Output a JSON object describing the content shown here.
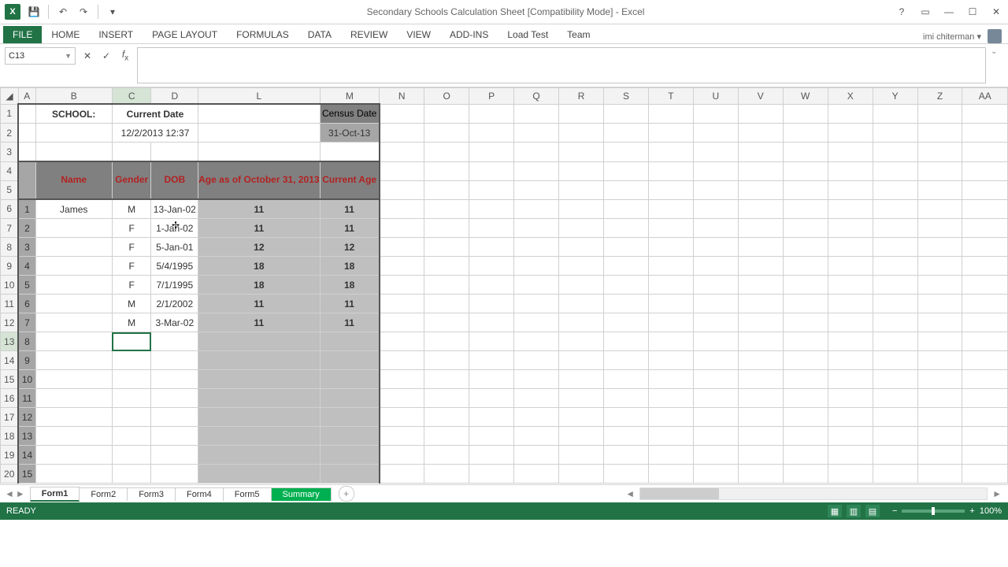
{
  "window": {
    "title": "Secondary Schools Calculation Sheet  [Compatibility Mode] - Excel"
  },
  "qat": {
    "save": "💾",
    "undo": "↶",
    "redo": "↷",
    "customize": "▾"
  },
  "ribbon": {
    "file": "FILE",
    "tabs": [
      "HOME",
      "INSERT",
      "PAGE LAYOUT",
      "FORMULAS",
      "DATA",
      "REVIEW",
      "VIEW",
      "ADD-INS",
      "Load Test",
      "Team"
    ]
  },
  "user": {
    "name": "imi chiterman ▾"
  },
  "formula_bar": {
    "cell_ref": "C13",
    "value": ""
  },
  "columns": [
    "A",
    "B",
    "C",
    "D",
    "L",
    "M",
    "N",
    "O",
    "P",
    "Q",
    "R",
    "S",
    "T",
    "U",
    "V",
    "W",
    "X",
    "Y",
    "Z",
    "AA"
  ],
  "sheet": {
    "school_label": "SCHOOL:",
    "current_date_label": "Current Date",
    "current_date_value": "12/2/2013 12:37",
    "census_label": "Census Date",
    "census_value": "31-Oct-13",
    "headers": {
      "name": "Name",
      "gender": "Gender",
      "dob": "DOB",
      "age_as_of": "Age as of October 31, 2013",
      "current_age": "Current Age"
    },
    "rows": [
      {
        "n": "1",
        "name": "James",
        "gender": "M",
        "dob": "13-Jan-02",
        "age": "11",
        "cur": "11"
      },
      {
        "n": "2",
        "name": "",
        "gender": "F",
        "dob": "1-Jan-02",
        "age": "11",
        "cur": "11"
      },
      {
        "n": "3",
        "name": "",
        "gender": "F",
        "dob": "5-Jan-01",
        "age": "12",
        "cur": "12"
      },
      {
        "n": "4",
        "name": "",
        "gender": "F",
        "dob": "5/4/1995",
        "age": "18",
        "cur": "18"
      },
      {
        "n": "5",
        "name": "",
        "gender": "F",
        "dob": "7/1/1995",
        "age": "18",
        "cur": "18"
      },
      {
        "n": "6",
        "name": "",
        "gender": "M",
        "dob": "2/1/2002",
        "age": "11",
        "cur": "11"
      },
      {
        "n": "7",
        "name": "",
        "gender": "M",
        "dob": "3-Mar-02",
        "age": "11",
        "cur": "11"
      },
      {
        "n": "8",
        "name": "",
        "gender": "",
        "dob": "",
        "age": "",
        "cur": ""
      },
      {
        "n": "9",
        "name": "",
        "gender": "",
        "dob": "",
        "age": "",
        "cur": ""
      },
      {
        "n": "10",
        "name": "",
        "gender": "",
        "dob": "",
        "age": "",
        "cur": ""
      },
      {
        "n": "11",
        "name": "",
        "gender": "",
        "dob": "",
        "age": "",
        "cur": ""
      },
      {
        "n": "12",
        "name": "",
        "gender": "",
        "dob": "",
        "age": "",
        "cur": ""
      },
      {
        "n": "13",
        "name": "",
        "gender": "",
        "dob": "",
        "age": "",
        "cur": ""
      },
      {
        "n": "14",
        "name": "",
        "gender": "",
        "dob": "",
        "age": "",
        "cur": ""
      },
      {
        "n": "15",
        "name": "",
        "gender": "",
        "dob": "",
        "age": "",
        "cur": ""
      }
    ]
  },
  "tabs": {
    "sheets": [
      "Form1",
      "Form2",
      "Form3",
      "Form4",
      "Form5",
      "Summary"
    ],
    "active": "Form1"
  },
  "status": {
    "left": "READY",
    "zoom": "100%"
  }
}
